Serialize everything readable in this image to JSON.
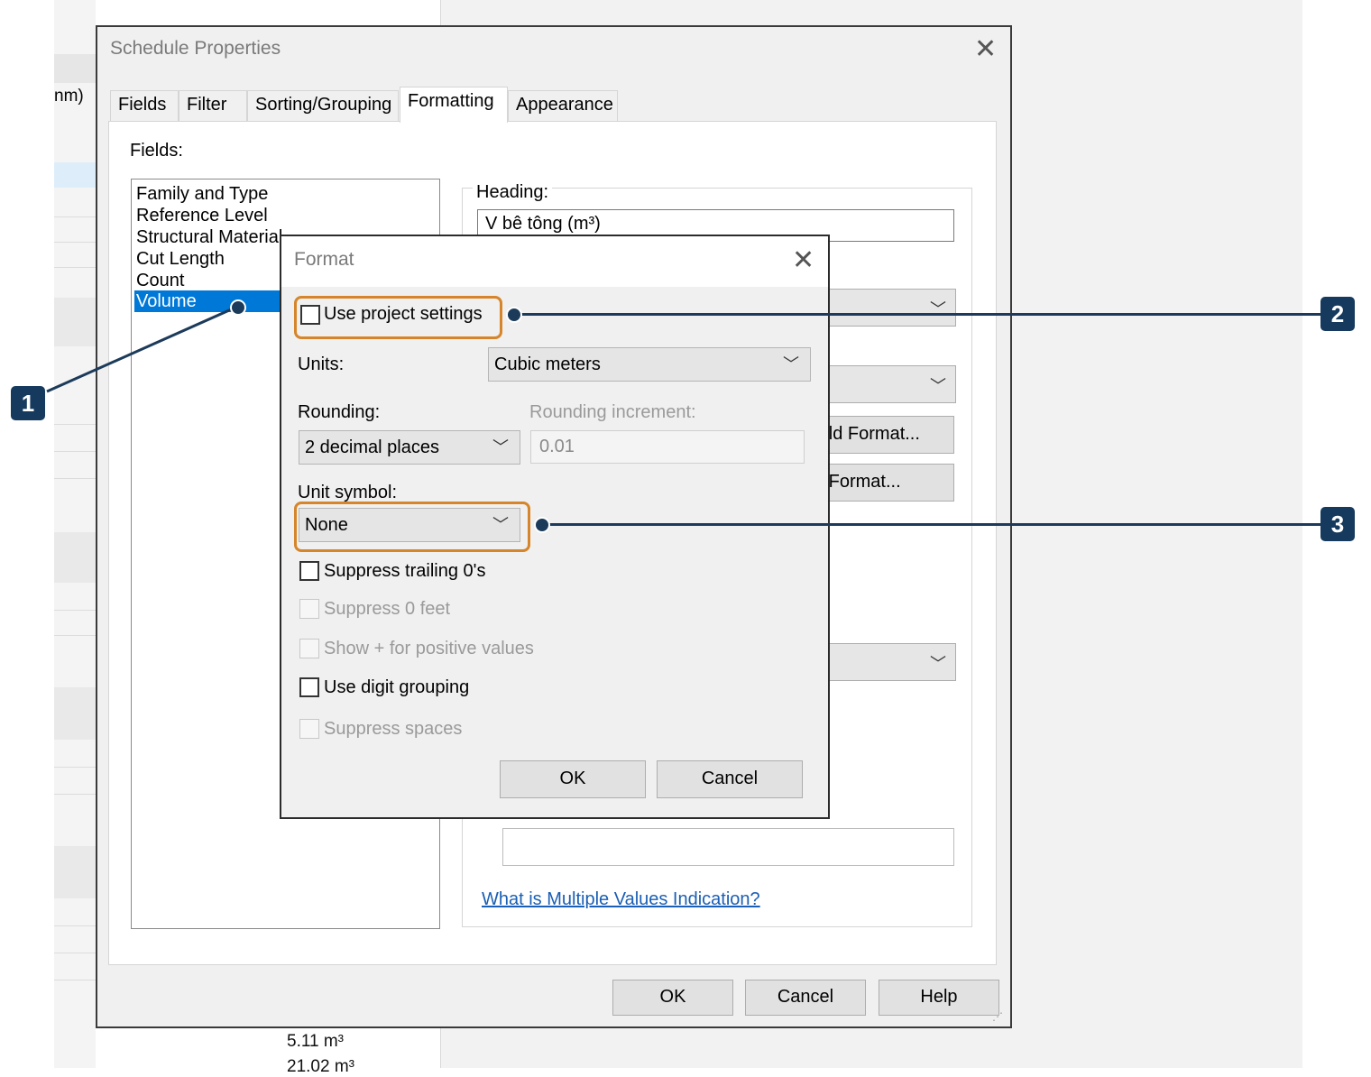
{
  "background": {
    "left_text": "nm)",
    "values": [
      "5.11 m³",
      "21.02 m³"
    ]
  },
  "schedule_properties": {
    "title": "Schedule Properties",
    "tabs": [
      {
        "label": "Fields"
      },
      {
        "label": "Filter"
      },
      {
        "label": "Sorting/Grouping"
      },
      {
        "label": "Formatting"
      },
      {
        "label": "Appearance"
      }
    ],
    "fields_label": "Fields:",
    "fields": [
      "Family and Type",
      "Reference Level",
      "Structural Material",
      "Cut Length",
      "Count",
      "Volume"
    ],
    "selected_field": "Volume",
    "heading_label": "Heading:",
    "heading_value": "V bê tông (m³)",
    "field_format_button": "Field Format...",
    "conditional_format_button": "Conditional Format...",
    "multiple_values_link": "What is Multiple Values Indication?",
    "buttons": {
      "ok": "OK",
      "cancel": "Cancel",
      "help": "Help"
    }
  },
  "format_dialog": {
    "title": "Format",
    "use_project_settings": {
      "label": "Use project settings",
      "checked": false
    },
    "units_label": "Units:",
    "units_value": "Cubic meters",
    "rounding_label": "Rounding:",
    "rounding_value": "2 decimal places",
    "rounding_increment_label": "Rounding increment:",
    "rounding_increment_value": "0.01",
    "unit_symbol_label": "Unit symbol:",
    "unit_symbol_value": "None",
    "options": [
      {
        "label": "Suppress trailing 0's",
        "checked": false,
        "enabled": true
      },
      {
        "label": "Suppress 0 feet",
        "checked": false,
        "enabled": false
      },
      {
        "label": "Show + for positive values",
        "checked": false,
        "enabled": false
      },
      {
        "label": "Use digit grouping",
        "checked": false,
        "enabled": true
      },
      {
        "label": "Suppress spaces",
        "checked": false,
        "enabled": false
      }
    ],
    "buttons": {
      "ok": "OK",
      "cancel": "Cancel"
    }
  },
  "callouts": [
    "1",
    "2",
    "3"
  ],
  "colors": {
    "highlight": "#d6852a",
    "callout": "#153a5e",
    "selection": "#0078d7",
    "link": "#1a5fb4"
  }
}
